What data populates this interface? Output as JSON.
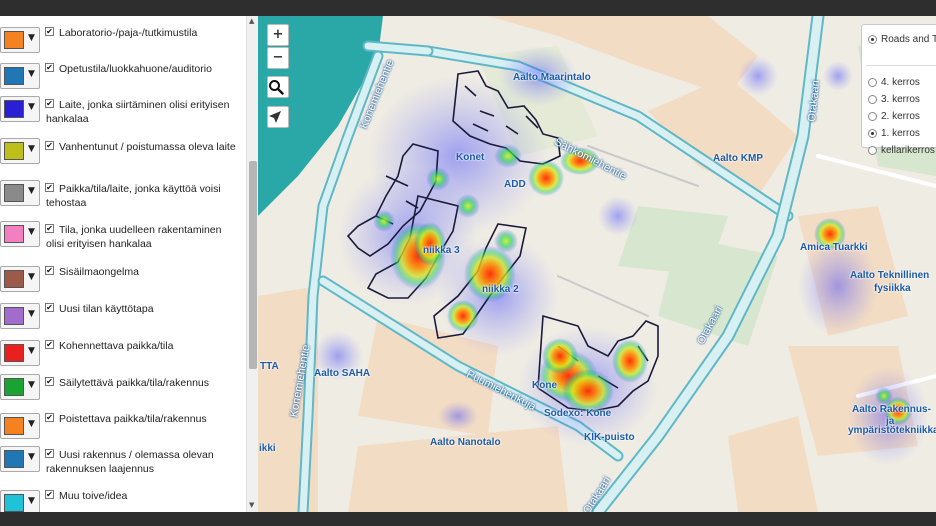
{
  "legend": {
    "items": [
      {
        "label": "Laboratorio-/paja-/tutkimustila",
        "color": "#f58220",
        "checked": true
      },
      {
        "label": "Opetustila/luokkahuone/auditorio",
        "color": "#1f78b4",
        "checked": true
      },
      {
        "label": "Laite, jonka siirtäminen olisi erityisen hankalaa",
        "color": "#2b1fd6",
        "checked": true
      },
      {
        "label": "Vanhentunut / poistumassa oleva laite",
        "color": "#bfbf1c",
        "checked": true
      },
      {
        "label": "Paikka/tila/laite, jonka käyttöä voisi tehostaa",
        "color": "#8a8a8a",
        "checked": true
      },
      {
        "label": "Tila, jonka uudelleen rakentaminen olisi erityisen hankalaa",
        "color": "#f27fc0",
        "checked": true
      },
      {
        "label": "Sisäilmaongelma",
        "color": "#9b5a4a",
        "checked": true
      },
      {
        "label": "Uusi tilan käyttötapa",
        "color": "#a16ccc",
        "checked": true
      },
      {
        "label": "Kohennettava paikka/tila",
        "color": "#e8201f",
        "checked": true
      },
      {
        "label": "Säilytettävä paikka/tila/rakennus",
        "color": "#18a332",
        "checked": true
      },
      {
        "label": "Poistettava paikka/tila/rakennus",
        "color": "#f58220",
        "checked": true
      },
      {
        "label": "Uusi rakennus / olemassa olevan rakennuksen laajennus",
        "color": "#1f78b4",
        "checked": true
      },
      {
        "label": "Muu toive/idea",
        "color": "#1fc2d6",
        "checked": true
      }
    ],
    "checkmark": "✔",
    "caret": "▼"
  },
  "map": {
    "zoom_in": "+",
    "zoom_out": "−",
    "search_icon": "magnifier",
    "locate_icon": "arrow",
    "place_labels": {
      "maarintalo": "Aalto Maarintalo",
      "kmp": "Aalto KMP",
      "konetekniikka": "Konet",
      "add": "ADD",
      "niikka3": "niikka 3",
      "niikka2": "niikka 2",
      "amica": "Amica Tuarkki",
      "tekn_fysiikka_1": "Aalto Teknillinen",
      "tekn_fysiikka_2": "fysiikka",
      "saha": "Aalto SAHA",
      "tta": "TTA",
      "nanotalo": "Aalto Nanotalo",
      "kone": "Kone",
      "sodexo": "Sodexo: Kone",
      "kik": "KIK-puisto",
      "rak1": "Aalto Rakennus-",
      "rak2": "ja",
      "rak3": "ympäristötekniikka",
      "ikki": "ikki"
    },
    "streets": {
      "sahkomiehentie": "Sähkömiehentie",
      "konemiehentie_top": "Konemiehentie",
      "konemiehentie_bottom": "Konemiehentie",
      "otakaari_top": "Otakaari",
      "otakaari_mid": "Otakaari",
      "otakaari_bottom": "Otakaari",
      "puumiehenkuja": "Puumiehenkuja"
    }
  },
  "layers": {
    "base": "Roads and T",
    "floors": [
      {
        "label": "4. kerros",
        "selected": false
      },
      {
        "label": "3. kerros",
        "selected": false
      },
      {
        "label": "2. kerros",
        "selected": false
      },
      {
        "label": "1. kerros",
        "selected": true
      },
      {
        "label": "kellarikerros",
        "selected": false
      }
    ]
  },
  "colors": {
    "road": "#d9f0f2",
    "road_border": "#5fb8c7",
    "water": "#2aa8a8",
    "park": "#d6e6cf",
    "building_area": "#f3dcc4",
    "label_blue": "#1d5aa6"
  }
}
